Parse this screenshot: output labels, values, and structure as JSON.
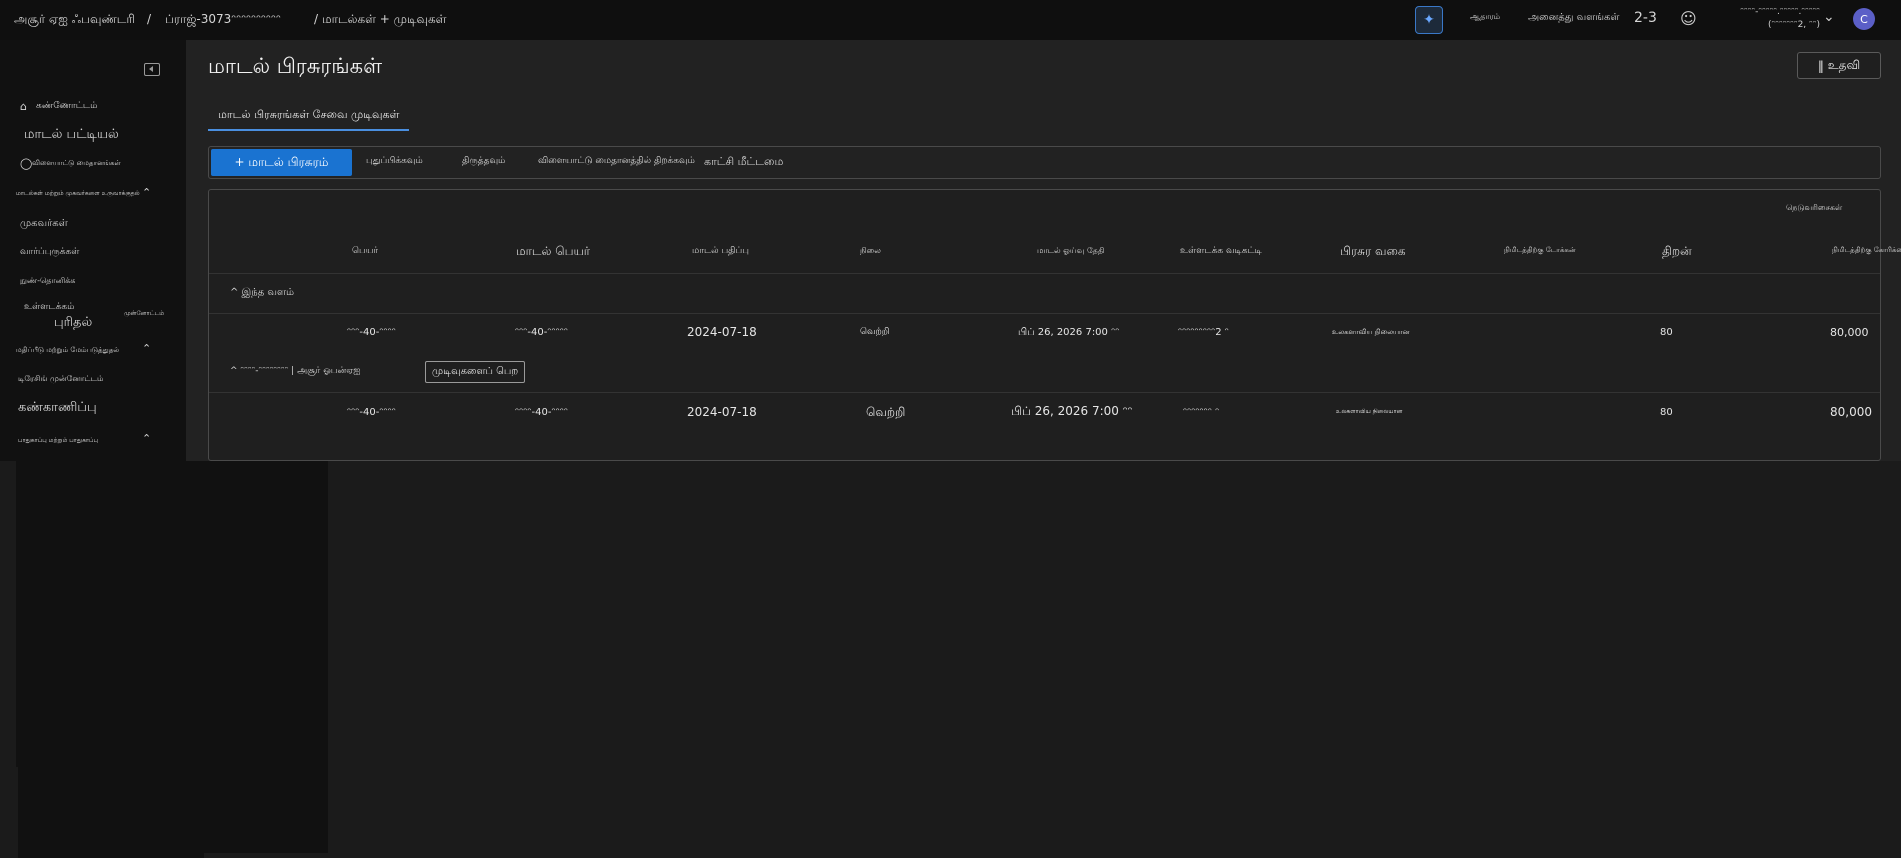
{
  "topbar": {
    "crumb_workspace": "அசூர் ஏஐ ஃபவுண்டரி",
    "crumb_project": "ப்ராஜ்-3073ᵔᵔᵔᵔᵔᵔᵔᵔᵔᵔ",
    "crumb_page": "மாடல்கள் + முடிவுகள்",
    "small_label": "ஆதாரம்",
    "all_resources": "அனைத்து வளங்கள்",
    "resource_count": "2-3",
    "account_line1": "ᵔᵔᵔᵔ-ᵔᵔᵔᵔᵔ.ᵔᵔᵔᵔᵔ.ᵔᵔᵔᵔᵔ",
    "account_line2": "(ᵔᵔᵔᵔᵔᵔᵔ2, ᵔᵔ)",
    "avatar_initial": "C"
  },
  "sidebar": {
    "items": [
      {
        "label": "கண்ணோட்டம்"
      },
      {
        "label": "மாடல் பட்டியல்"
      },
      {
        "label": "விளையாட்டு மைதானங்கள்"
      }
    ],
    "group1": "மாடல்கள் மற்றும் முகவர்களை உருவாக்குதல்",
    "group1_items": [
      {
        "label": "முகவர்கள்"
      },
      {
        "label": "வார்ப்புருக்கள்"
      },
      {
        "label": "நுண்-தொனிக்க"
      },
      {
        "label": "உள்ளடக்கம்"
      },
      {
        "label": "புரிதல்"
      },
      {
        "label": "முன்னோட்டம்"
      }
    ],
    "group2": "மதிப்பீடு மற்றும் மேம்படுத்துதல்",
    "group2_items": [
      {
        "label": "டிரேசிங் முன்னோட்டம்"
      },
      {
        "label": "கண்காணிப்பு"
      },
      {
        "label": "பாதுகாப்பு மற்றும் பாதுகாப்பு"
      }
    ]
  },
  "main": {
    "title": "மாடல் பிரசுரங்கள்",
    "help": "உதவி",
    "tab": "மாடல் பிரசுரங்கள் சேவை முடிவுகள்",
    "toolbar": {
      "primary": "+ மாடல் பிரசுரம்",
      "refresh": "புதுப்பிக்கவும்",
      "edit": "திருத்தவும்",
      "playground": "விளையாட்டு மைதானத்தில் திறக்கவும்",
      "reset_view": "காட்சி மீட்டமை"
    },
    "columns_btn": "நெடுவரிசைகள்",
    "headers": {
      "name": "பெயர்",
      "model_name": "மாடல் பெயர்",
      "model_version": "மாடல் பதிப்பு",
      "state": "நிலை",
      "retire_date": "மாடல் ஓய்வு தேதி",
      "content_filter": "உள்ளடக்க வடிகட்டி",
      "deploy_type": "பிரசுர வகை",
      "rate_limit": "நிமிடத்திற்கு டோக்கன்",
      "capacity": "திறன்",
      "tpm": "நிமிடத்திற்கு கோரிக்கை"
    },
    "groups": [
      {
        "label": "^ இந்த வளம்"
      },
      {
        "label": "^ ᵔᵔᵔᵔ-ᵔᵔᵔᵔᵔᵔᵔᵔ | அசூர் ஓபன்ஏஐ",
        "action": "முடிவுகளைப் பெற"
      }
    ],
    "rows": [
      {
        "name": "ᵔᵔᵔ-40-ᵔᵔᵔᵔ",
        "model_name": "ᵔᵔᵔ-40-ᵔᵔᵔᵔᵔ",
        "model_version": "2024-07-18",
        "state": "வெற்றி",
        "retire_date": "பிப் 26, 2026 7:00 ᵔᵔ",
        "content_filter": "ᵔᵔᵔᵔᵔᵔᵔᵔᵔ2 ᵔ",
        "deploy_type": "உலகளாவிய நிலையான",
        "capacity": "80",
        "tpm": "80,000"
      },
      {
        "name": "ᵔᵔᵔ-40-ᵔᵔᵔᵔ",
        "model_name": "ᵔᵔᵔᵔ-40-ᵔᵔᵔᵔ",
        "model_version": "2024-07-18",
        "state": "வெற்றி",
        "retire_date": "பிப் 26, 2026 7:00 ᵔᵔ",
        "content_filter": "ᵔᵔᵔᵔᵔᵔᵔ ᵔ",
        "deploy_type": "உலகளாவிய நிலையான",
        "capacity": "80",
        "tpm": "80,000"
      }
    ]
  }
}
